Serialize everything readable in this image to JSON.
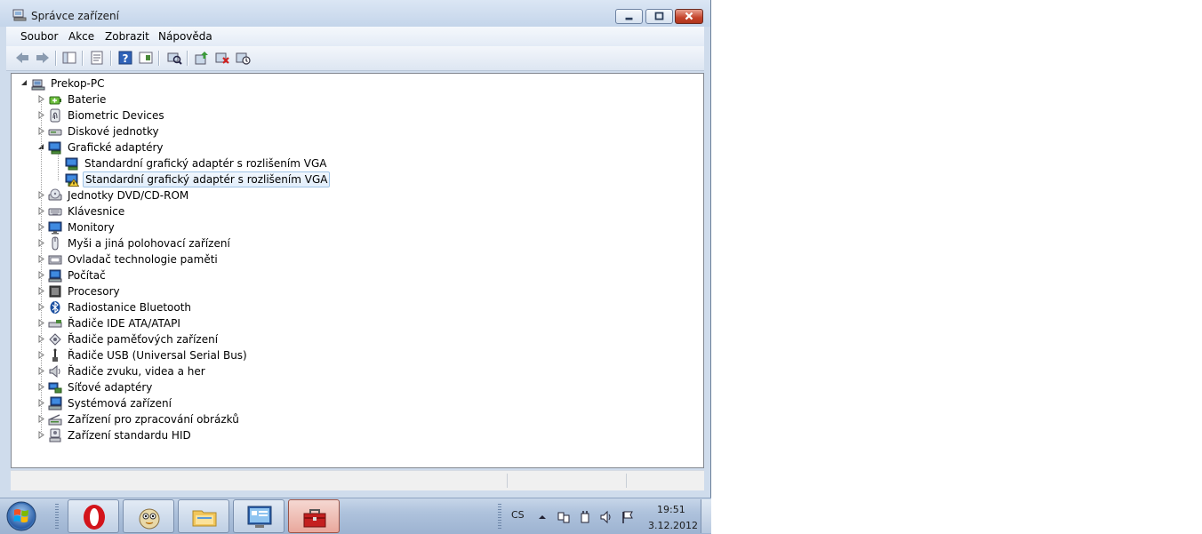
{
  "window": {
    "title": "Správce zařízení"
  },
  "menu": [
    "Soubor",
    "Akce",
    "Zobrazit",
    "Nápověda"
  ],
  "tree": {
    "root": "Prekop-PC",
    "categories": [
      {
        "label": "Baterie",
        "icon": "battery-icon",
        "expanded": false
      },
      {
        "label": "Biometric Devices",
        "icon": "fingerprint-icon",
        "expanded": false
      },
      {
        "label": "Diskové jednotky",
        "icon": "disk-drive-icon",
        "expanded": false
      },
      {
        "label": "Grafické adaptéry",
        "icon": "display-adapter-icon",
        "expanded": true,
        "children": [
          {
            "label": "Standardní grafický adaptér s rozlišením VGA",
            "icon": "display-adapter-icon",
            "warning": false,
            "selected": false
          },
          {
            "label": "Standardní grafický adaptér s rozlišením VGA",
            "icon": "display-adapter-warning-icon",
            "warning": true,
            "selected": true
          }
        ]
      },
      {
        "label": "Jednotky DVD/CD-ROM",
        "icon": "dvd-drive-icon",
        "expanded": false
      },
      {
        "label": "Klávesnice",
        "icon": "keyboard-icon",
        "expanded": false
      },
      {
        "label": "Monitory",
        "icon": "monitor-icon",
        "expanded": false
      },
      {
        "label": "Myši a jiná polohovací zařízení",
        "icon": "mouse-icon",
        "expanded": false
      },
      {
        "label": "Ovladač technologie paměti",
        "icon": "memory-controller-icon",
        "expanded": false
      },
      {
        "label": "Počítač",
        "icon": "computer-icon",
        "expanded": false
      },
      {
        "label": "Procesory",
        "icon": "processor-icon",
        "expanded": false
      },
      {
        "label": "Radiostanice Bluetooth",
        "icon": "bluetooth-icon",
        "expanded": false
      },
      {
        "label": "Řadiče IDE ATA/ATAPI",
        "icon": "ide-controller-icon",
        "expanded": false
      },
      {
        "label": "Řadiče paměťových zařízení",
        "icon": "storage-controller-icon",
        "expanded": false
      },
      {
        "label": "Řadiče USB (Universal Serial Bus)",
        "icon": "usb-icon",
        "expanded": false
      },
      {
        "label": "Řadiče zvuku, videa a her",
        "icon": "speaker-icon",
        "expanded": false
      },
      {
        "label": "Síťové adaptéry",
        "icon": "network-adapter-icon",
        "expanded": false
      },
      {
        "label": "Systémová zařízení",
        "icon": "system-device-icon",
        "expanded": false
      },
      {
        "label": "Zařízení pro zpracování obrázků",
        "icon": "scanner-icon",
        "expanded": false
      },
      {
        "label": "Zařízení standardu HID",
        "icon": "hid-icon",
        "expanded": false
      }
    ]
  },
  "taskbar": {
    "apps": [
      "opera-icon",
      "pidgin-icon",
      "explorer-folder-icon",
      "control-panel-icon",
      "device-manager-toolbox-icon"
    ],
    "language": "CS",
    "time": "19:51",
    "date": "3.12.2012"
  },
  "colors": {
    "selection_border": "#9ec3e6",
    "close_button": "#c4432b",
    "taskbar": "#aec2dc"
  }
}
